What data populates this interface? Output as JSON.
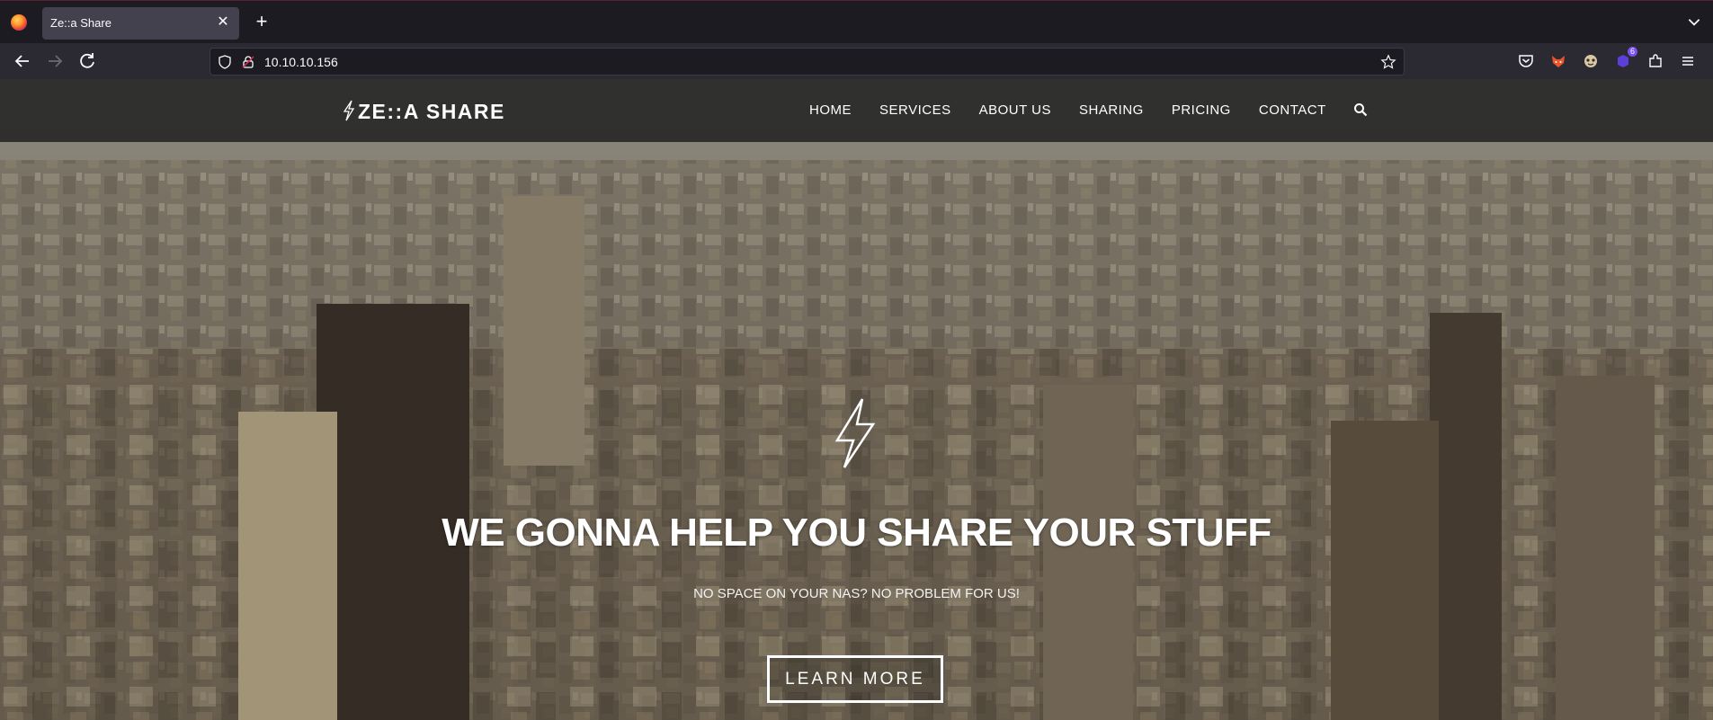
{
  "browser": {
    "tab_title": "Ze::a Share",
    "url": "10.10.10.156",
    "extension_badge": "6",
    "accent": "#7950f2"
  },
  "site": {
    "logo": "ZE::A SHARE",
    "menu": [
      "HOME",
      "SERVICES",
      "ABOUT US",
      "SHARING",
      "PRICING",
      "CONTACT"
    ]
  },
  "hero": {
    "title": "WE GONNA HELP YOU SHARE YOUR STUFF",
    "subtitle": "NO SPACE ON YOUR NAS? NO PROBLEM FOR US!",
    "button": "LEARN MORE"
  }
}
